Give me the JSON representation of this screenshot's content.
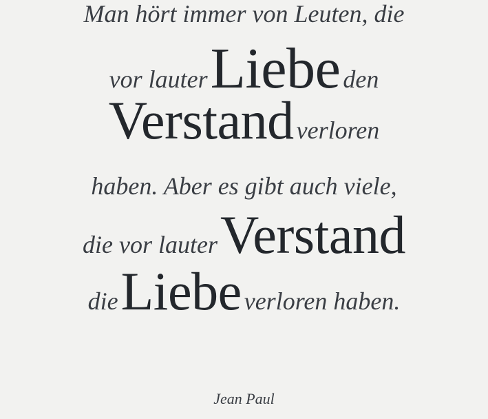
{
  "quote": {
    "line1": "Man hört immer von Leuten, die",
    "line2": {
      "pre": "vor lauter",
      "big": "Liebe",
      "post": "den"
    },
    "line3": {
      "big": "Verstand",
      "post": "verloren"
    },
    "line4": "haben. Aber es gibt auch viele,",
    "line5": {
      "pre": "die vor lauter",
      "big": "Verstand"
    },
    "line6": {
      "pre": "die",
      "big": "Liebe",
      "post": "verloren haben."
    }
  },
  "author": "Jean Paul"
}
